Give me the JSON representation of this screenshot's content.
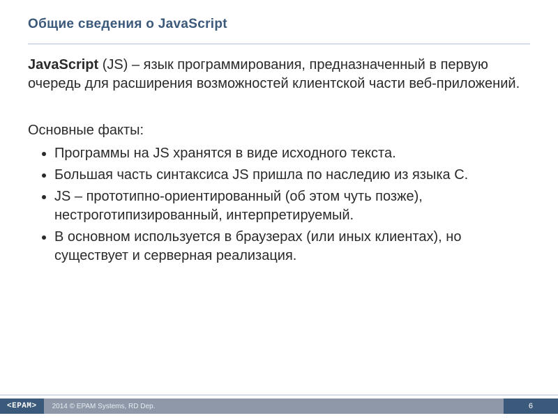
{
  "slide": {
    "title": "Общие сведения о JavaScript",
    "definition_bold": "JavaScript",
    "definition_paren": " (JS) – язык программирования, предназначенный в первую очередь для расширения возможностей клиентской части веб-приложений.",
    "subhead": "Основные факты:",
    "bullets": [
      "Программы на JS хранятся в виде исходного текста.",
      "Большая часть синтаксиса JS пришла по наследию из языка C.",
      "JS – прототипно-ориентированный (об этом чуть позже), нестроготипизированный, интерпретируемый.",
      "В основном используется в браузерах (или иных клиентах), но существует и серверная реализация."
    ]
  },
  "footer": {
    "logo": "<EPAM>",
    "copyright": "2014 © EPAM Systems, RD Dep.",
    "page": "6"
  }
}
